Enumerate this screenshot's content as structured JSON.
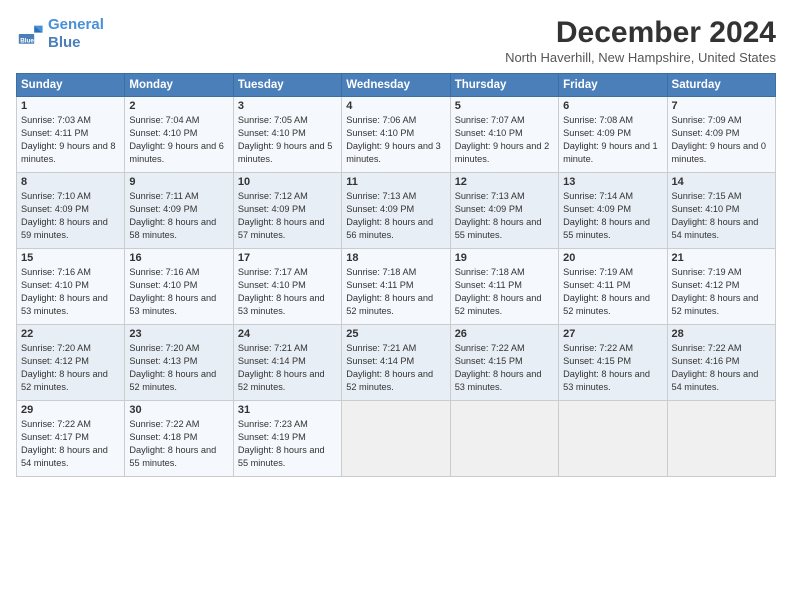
{
  "logo": {
    "line1": "General",
    "line2": "Blue"
  },
  "title": "December 2024",
  "location": "North Haverhill, New Hampshire, United States",
  "days_header": [
    "Sunday",
    "Monday",
    "Tuesday",
    "Wednesday",
    "Thursday",
    "Friday",
    "Saturday"
  ],
  "weeks": [
    [
      {
        "day": "1",
        "sunrise": "7:03 AM",
        "sunset": "4:11 PM",
        "daylight": "9 hours and 8 minutes."
      },
      {
        "day": "2",
        "sunrise": "7:04 AM",
        "sunset": "4:10 PM",
        "daylight": "9 hours and 6 minutes."
      },
      {
        "day": "3",
        "sunrise": "7:05 AM",
        "sunset": "4:10 PM",
        "daylight": "9 hours and 5 minutes."
      },
      {
        "day": "4",
        "sunrise": "7:06 AM",
        "sunset": "4:10 PM",
        "daylight": "9 hours and 3 minutes."
      },
      {
        "day": "5",
        "sunrise": "7:07 AM",
        "sunset": "4:10 PM",
        "daylight": "9 hours and 2 minutes."
      },
      {
        "day": "6",
        "sunrise": "7:08 AM",
        "sunset": "4:09 PM",
        "daylight": "9 hours and 1 minute."
      },
      {
        "day": "7",
        "sunrise": "7:09 AM",
        "sunset": "4:09 PM",
        "daylight": "9 hours and 0 minutes."
      }
    ],
    [
      {
        "day": "8",
        "sunrise": "7:10 AM",
        "sunset": "4:09 PM",
        "daylight": "8 hours and 59 minutes."
      },
      {
        "day": "9",
        "sunrise": "7:11 AM",
        "sunset": "4:09 PM",
        "daylight": "8 hours and 58 minutes."
      },
      {
        "day": "10",
        "sunrise": "7:12 AM",
        "sunset": "4:09 PM",
        "daylight": "8 hours and 57 minutes."
      },
      {
        "day": "11",
        "sunrise": "7:13 AM",
        "sunset": "4:09 PM",
        "daylight": "8 hours and 56 minutes."
      },
      {
        "day": "12",
        "sunrise": "7:13 AM",
        "sunset": "4:09 PM",
        "daylight": "8 hours and 55 minutes."
      },
      {
        "day": "13",
        "sunrise": "7:14 AM",
        "sunset": "4:09 PM",
        "daylight": "8 hours and 55 minutes."
      },
      {
        "day": "14",
        "sunrise": "7:15 AM",
        "sunset": "4:10 PM",
        "daylight": "8 hours and 54 minutes."
      }
    ],
    [
      {
        "day": "15",
        "sunrise": "7:16 AM",
        "sunset": "4:10 PM",
        "daylight": "8 hours and 53 minutes."
      },
      {
        "day": "16",
        "sunrise": "7:16 AM",
        "sunset": "4:10 PM",
        "daylight": "8 hours and 53 minutes."
      },
      {
        "day": "17",
        "sunrise": "7:17 AM",
        "sunset": "4:10 PM",
        "daylight": "8 hours and 53 minutes."
      },
      {
        "day": "18",
        "sunrise": "7:18 AM",
        "sunset": "4:11 PM",
        "daylight": "8 hours and 52 minutes."
      },
      {
        "day": "19",
        "sunrise": "7:18 AM",
        "sunset": "4:11 PM",
        "daylight": "8 hours and 52 minutes."
      },
      {
        "day": "20",
        "sunrise": "7:19 AM",
        "sunset": "4:11 PM",
        "daylight": "8 hours and 52 minutes."
      },
      {
        "day": "21",
        "sunrise": "7:19 AM",
        "sunset": "4:12 PM",
        "daylight": "8 hours and 52 minutes."
      }
    ],
    [
      {
        "day": "22",
        "sunrise": "7:20 AM",
        "sunset": "4:12 PM",
        "daylight": "8 hours and 52 minutes."
      },
      {
        "day": "23",
        "sunrise": "7:20 AM",
        "sunset": "4:13 PM",
        "daylight": "8 hours and 52 minutes."
      },
      {
        "day": "24",
        "sunrise": "7:21 AM",
        "sunset": "4:14 PM",
        "daylight": "8 hours and 52 minutes."
      },
      {
        "day": "25",
        "sunrise": "7:21 AM",
        "sunset": "4:14 PM",
        "daylight": "8 hours and 52 minutes."
      },
      {
        "day": "26",
        "sunrise": "7:22 AM",
        "sunset": "4:15 PM",
        "daylight": "8 hours and 53 minutes."
      },
      {
        "day": "27",
        "sunrise": "7:22 AM",
        "sunset": "4:15 PM",
        "daylight": "8 hours and 53 minutes."
      },
      {
        "day": "28",
        "sunrise": "7:22 AM",
        "sunset": "4:16 PM",
        "daylight": "8 hours and 54 minutes."
      }
    ],
    [
      {
        "day": "29",
        "sunrise": "7:22 AM",
        "sunset": "4:17 PM",
        "daylight": "8 hours and 54 minutes."
      },
      {
        "day": "30",
        "sunrise": "7:22 AM",
        "sunset": "4:18 PM",
        "daylight": "8 hours and 55 minutes."
      },
      {
        "day": "31",
        "sunrise": "7:23 AM",
        "sunset": "4:19 PM",
        "daylight": "8 hours and 55 minutes."
      },
      null,
      null,
      null,
      null
    ]
  ]
}
